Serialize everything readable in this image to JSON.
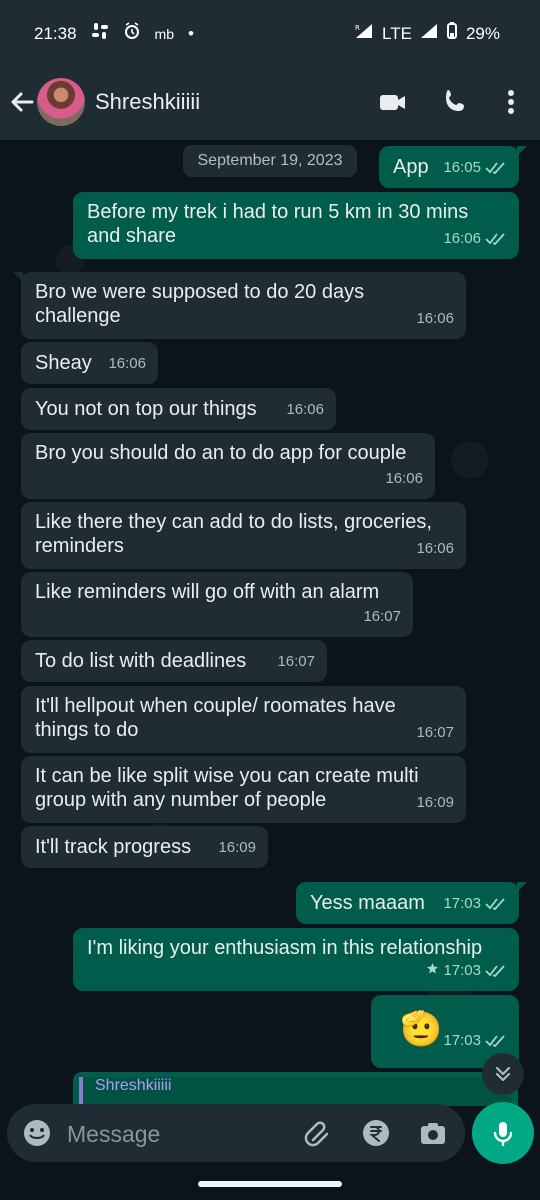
{
  "status": {
    "time": "21:38",
    "mb": "mb",
    "network": "LTE",
    "battery": "29%"
  },
  "header": {
    "contact_name": "Shreshkiiiii"
  },
  "date_chip": "September 19, 2023",
  "messages": [
    {
      "text": "App",
      "time": "16:05"
    },
    {
      "text": "Before my trek i had to run 5 km in 30 mins and share",
      "time": "16:06"
    },
    {
      "text": "Bro we were supposed to do 20 days challenge",
      "time": "16:06"
    },
    {
      "text": "Sheay",
      "time": "16:06"
    },
    {
      "text": "You not on top our things",
      "time": "16:06"
    },
    {
      "text": "Bro you should do an to do app for couple",
      "time": "16:06"
    },
    {
      "text": "Like there they can add to do lists, groceries, reminders",
      "time": "16:06"
    },
    {
      "text": "Like reminders will go off with an alarm",
      "time": "16:07"
    },
    {
      "text": "To do list with deadlines",
      "time": "16:07"
    },
    {
      "text": "It'll hellpout when couple/ roomates have things to do",
      "time": "16:07"
    },
    {
      "text": "It can be like split wise you can create multi group with any number of people",
      "time": "16:09"
    },
    {
      "text": "It'll track progress",
      "time": "16:09"
    },
    {
      "text": "Yess maaam",
      "time": "17:03"
    },
    {
      "text": "I'm liking your enthusiasm in this relationship",
      "time": "17:03"
    },
    {
      "text": "🫡",
      "time": "17:03"
    }
  ],
  "quoted_preview": "Shreshkiiiii",
  "composer": {
    "placeholder": "Message"
  },
  "colors": {
    "incoming_bubble": "#202c33",
    "outgoing_bubble": "#005c4b",
    "accent": "#00a884",
    "background": "#0b141a"
  }
}
